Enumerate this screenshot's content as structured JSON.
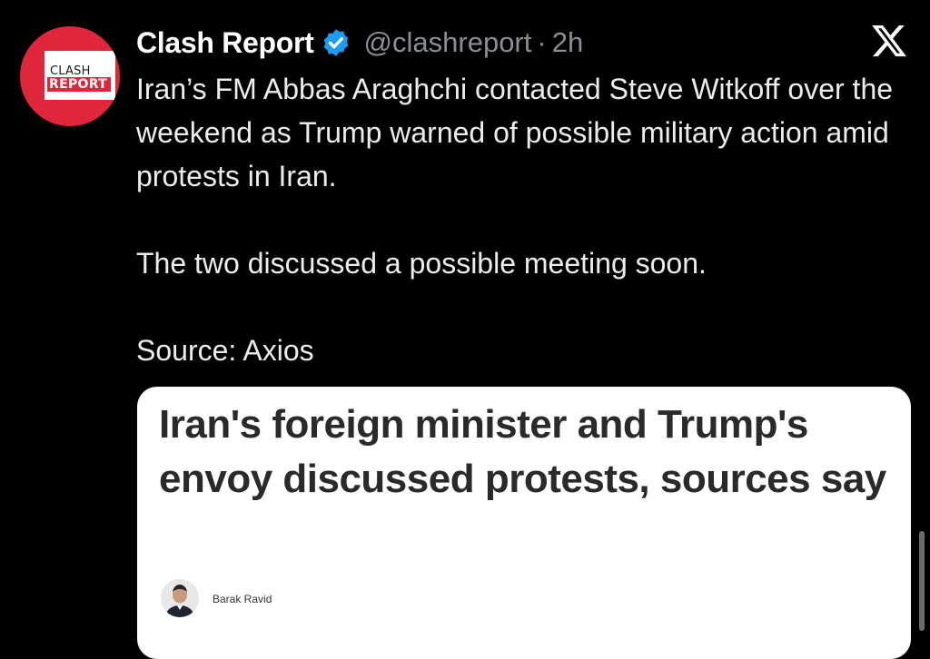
{
  "tweet": {
    "display_name": "Clash Report",
    "handle": "@clashreport",
    "separator": "·",
    "time": "2h",
    "avatar": {
      "line1": "CLASH",
      "line2": "REPORT",
      "brand_color": "#e0263a"
    },
    "verified_color": "#1d9bf0",
    "text_paragraphs": [
      "Iran’s FM Abbas Araghchi contacted Steve Witkoff over the weekend as Trump warned of possible military action amid protests in Iran.",
      "The two discussed a possible meeting soon.",
      "Source: Axios"
    ],
    "icons": {
      "verified": "verified-badge-icon",
      "platform": "x-logo-icon"
    }
  },
  "link_card": {
    "headline": "Iran's foreign minister and Trump's envoy discussed protests, sources say",
    "author": "Barak Ravid"
  }
}
